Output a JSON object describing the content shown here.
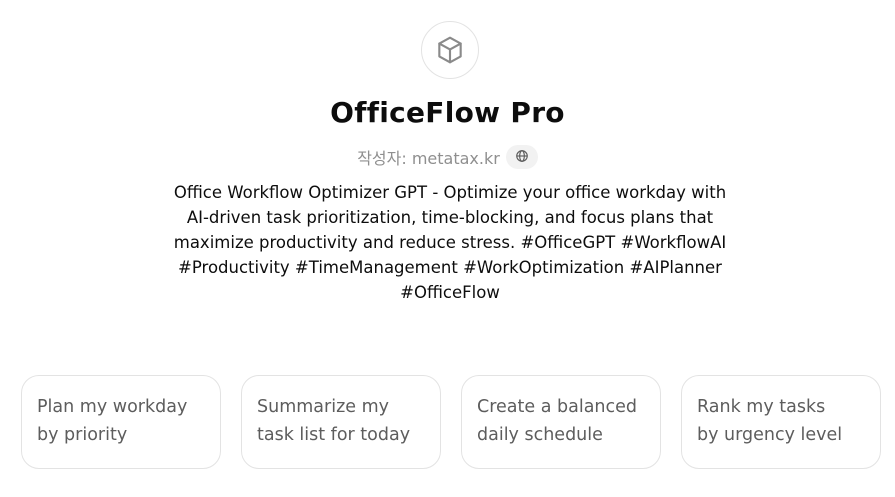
{
  "gpt": {
    "icon": "cube-icon",
    "title": "OfficeFlow Pro",
    "author_label": "작성자: metatax.kr",
    "author_link_icon": "globe-icon",
    "description": "Office Workflow Optimizer GPT - Optimize your office workday with AI-driven task prioritization, time-blocking, and focus plans that maximize productivity and reduce stress. #OfficeGPT #WorkflowAI #Productivity #TimeManagement #WorkOptimization #AIPlanner #OfficeFlow"
  },
  "conversation_starters": [
    {
      "label": "Plan my workday\nby priority"
    },
    {
      "label": "Summarize my\ntask list for today"
    },
    {
      "label": "Create a balanced\ndaily schedule"
    },
    {
      "label": "Rank my tasks\nby urgency level"
    }
  ],
  "colors": {
    "title": "#0d0d0d",
    "muted": "#8f8f8f",
    "card_text": "#5d5d5d",
    "border": "#e3e3e3",
    "chip_bg": "#f2f2f2"
  }
}
